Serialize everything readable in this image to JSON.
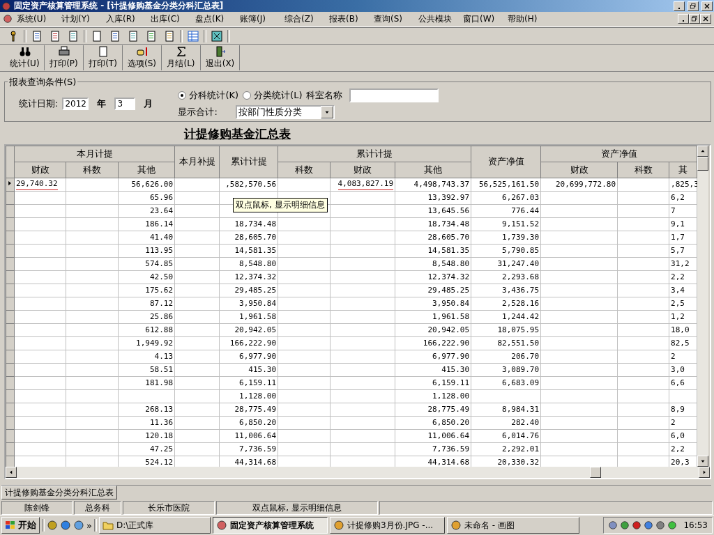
{
  "window": {
    "title": "固定资产核算管理系统 - [计提修购基金分类分科汇总表]"
  },
  "menu": [
    "系统(U)",
    "计划(Y)",
    "入库(R)",
    "出库(C)",
    "盘点(K)",
    "账簿(J)",
    "综合(Z)",
    "报表(B)",
    "查询(S)",
    "公共模块",
    "窗口(W)",
    "帮助(H)"
  ],
  "toolbar_buttons": [
    {
      "label": "统计(U)"
    },
    {
      "label": "打印(P)"
    },
    {
      "label": "打印(T)"
    },
    {
      "label": "选项(S)"
    },
    {
      "label": "月结(L)"
    },
    {
      "label": "退出(X)"
    }
  ],
  "query": {
    "legend": "报表查询条件(S)",
    "date_label": "统计日期:",
    "year": "2012",
    "year_label": "年",
    "month": "3",
    "month_label": "月",
    "radios": [
      {
        "label": "分科统计(K)",
        "selected": true
      },
      {
        "label": "分类统计(L)",
        "selected": false
      }
    ],
    "dept_label": "科室名称",
    "summary_label": "显示合计:",
    "summary_value": "按部门性质分类"
  },
  "report_title": "计提修购基金汇总表",
  "table": {
    "groups": [
      {
        "label": "本月计提",
        "columns": [
          "财政",
          "科数",
          "其他"
        ]
      },
      {
        "label": "本月补提"
      },
      {
        "label": "累计计提"
      },
      {
        "label": "累计计提",
        "columns": [
          "科数",
          "财政",
          "其他"
        ]
      },
      {
        "label": "资产净值"
      },
      {
        "label": "资产净值",
        "columns": [
          "财政",
          "科数",
          "其"
        ]
      }
    ],
    "rows": [
      {
        "selected": true,
        "cells": [
          {
            "text": "29,740.32",
            "underlined": true
          },
          "",
          "56,626.00",
          "",
          ",582,570.56",
          "",
          {
            "text": "4,083,827.19",
            "underlined": true
          },
          "4,498,743.37",
          "56,525,161.50",
          "20,699,772.80",
          "",
          ",825,3"
        ]
      },
      {
        "selected": false,
        "cells": [
          "",
          "",
          "65.96",
          "",
          "",
          "",
          "",
          "13,392.97",
          "6,267.03",
          "",
          "",
          "6,2"
        ]
      },
      {
        "selected": false,
        "cells": [
          "",
          "",
          "23.64",
          "",
          "",
          "",
          "",
          "13,645.56",
          "776.44",
          "",
          "",
          "7"
        ]
      },
      {
        "selected": false,
        "cells": [
          "",
          "",
          "186.14",
          "",
          "18,734.48",
          "",
          "",
          "18,734.48",
          "9,151.52",
          "",
          "",
          "9,1"
        ]
      },
      {
        "selected": false,
        "cells": [
          "",
          "",
          "41.40",
          "",
          "28,605.70",
          "",
          "",
          "28,605.70",
          "1,739.30",
          "",
          "",
          "1,7"
        ]
      },
      {
        "selected": false,
        "cells": [
          "",
          "",
          "113.95",
          "",
          "14,581.35",
          "",
          "",
          "14,581.35",
          "5,790.85",
          "",
          "",
          "5,7"
        ]
      },
      {
        "selected": false,
        "cells": [
          "",
          "",
          "574.85",
          "",
          "8,548.80",
          "",
          "",
          "8,548.80",
          "31,247.40",
          "",
          "",
          "31,2"
        ]
      },
      {
        "selected": false,
        "cells": [
          "",
          "",
          "42.50",
          "",
          "12,374.32",
          "",
          "",
          "12,374.32",
          "2,293.68",
          "",
          "",
          "2,2"
        ]
      },
      {
        "selected": false,
        "cells": [
          "",
          "",
          "175.62",
          "",
          "29,485.25",
          "",
          "",
          "29,485.25",
          "3,436.75",
          "",
          "",
          "3,4"
        ]
      },
      {
        "selected": false,
        "cells": [
          "",
          "",
          "87.12",
          "",
          "3,950.84",
          "",
          "",
          "3,950.84",
          "2,528.16",
          "",
          "",
          "2,5"
        ]
      },
      {
        "selected": false,
        "cells": [
          "",
          "",
          "25.86",
          "",
          "1,961.58",
          "",
          "",
          "1,961.58",
          "1,244.42",
          "",
          "",
          "1,2"
        ]
      },
      {
        "selected": false,
        "cells": [
          "",
          "",
          "612.88",
          "",
          "20,942.05",
          "",
          "",
          "20,942.05",
          "18,075.95",
          "",
          "",
          "18,0"
        ]
      },
      {
        "selected": false,
        "cells": [
          "",
          "",
          "1,949.92",
          "",
          "166,222.90",
          "",
          "",
          "166,222.90",
          "82,551.50",
          "",
          "",
          "82,5"
        ]
      },
      {
        "selected": false,
        "cells": [
          "",
          "",
          "4.13",
          "",
          "6,977.90",
          "",
          "",
          "6,977.90",
          "206.70",
          "",
          "",
          "2"
        ]
      },
      {
        "selected": false,
        "cells": [
          "",
          "",
          "58.51",
          "",
          "415.30",
          "",
          "",
          "415.30",
          "3,089.70",
          "",
          "",
          "3,0"
        ]
      },
      {
        "selected": false,
        "cells": [
          "",
          "",
          "181.98",
          "",
          "6,159.11",
          "",
          "",
          "6,159.11",
          "6,683.09",
          "",
          "",
          "6,6"
        ]
      },
      {
        "selected": false,
        "cells": [
          "",
          "",
          "",
          "",
          "1,128.00",
          "",
          "",
          "1,128.00",
          "",
          "",
          "",
          ""
        ]
      },
      {
        "selected": false,
        "cells": [
          "",
          "",
          "268.13",
          "",
          "28,775.49",
          "",
          "",
          "28,775.49",
          "8,984.31",
          "",
          "",
          "8,9"
        ]
      },
      {
        "selected": false,
        "cells": [
          "",
          "",
          "11.36",
          "",
          "6,850.20",
          "",
          "",
          "6,850.20",
          "282.40",
          "",
          "",
          "2"
        ]
      },
      {
        "selected": false,
        "cells": [
          "",
          "",
          "120.18",
          "",
          "11,006.64",
          "",
          "",
          "11,006.64",
          "6,014.76",
          "",
          "",
          "6,0"
        ]
      },
      {
        "selected": false,
        "cells": [
          "",
          "",
          "47.25",
          "",
          "7,736.59",
          "",
          "",
          "7,736.59",
          "2,292.01",
          "",
          "",
          "2,2"
        ]
      },
      {
        "selected": false,
        "cells": [
          "",
          "",
          "524.12",
          "",
          "44,314.68",
          "",
          "",
          "44,314.68",
          "20,330.32",
          "",
          "",
          "20,3"
        ]
      }
    ]
  },
  "tooltip": "双点鼠标, 显示明细信息",
  "doc_tab": "计提修购基金分类分科汇总表",
  "status_bar": [
    "陈剑锋",
    "总务科",
    "长乐市医院",
    "双点鼠标, 显示明细信息"
  ],
  "taskbar": {
    "start": "开始",
    "tasks": [
      {
        "label": "D:\\正式库",
        "selected": false
      },
      {
        "label": "固定资产核算管理系统",
        "selected": true
      },
      {
        "label": "计提修购3月份.JPG -...",
        "selected": false
      },
      {
        "label": "未命名 - 画图",
        "selected": false
      }
    ],
    "chevron": "»",
    "clock": "16:53"
  }
}
